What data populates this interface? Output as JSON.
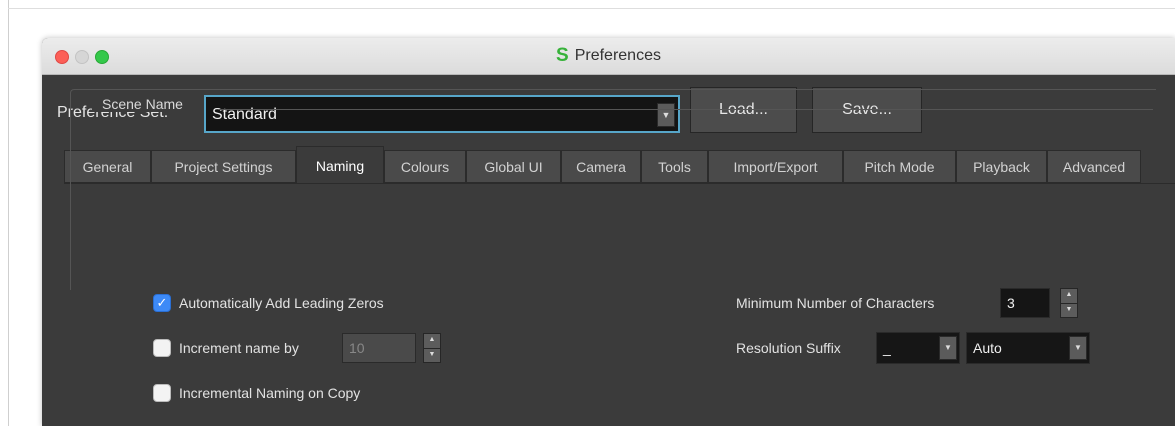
{
  "window": {
    "title": "Preferences",
    "app_icon": "S"
  },
  "toolbar": {
    "preference_set_label": "Preference Set:",
    "preference_set_value": "Standard",
    "load_label": "Load...",
    "save_label": "Save..."
  },
  "tabs": [
    {
      "label": "General"
    },
    {
      "label": "Project Settings"
    },
    {
      "label": "Naming",
      "active": true
    },
    {
      "label": "Colours"
    },
    {
      "label": "Global UI"
    },
    {
      "label": "Camera"
    },
    {
      "label": "Tools"
    },
    {
      "label": "Import/Export"
    },
    {
      "label": "Pitch Mode"
    },
    {
      "label": "Playback"
    },
    {
      "label": "Advanced"
    }
  ],
  "scene_name": {
    "group_title": "Scene Name",
    "auto_leading_zeros": {
      "label": "Automatically Add Leading Zeros",
      "checked": true
    },
    "increment_name": {
      "label": "Increment name by",
      "checked": false,
      "value": "10"
    },
    "incremental_copy": {
      "label": "Incremental Naming on Copy",
      "checked": false
    },
    "min_chars": {
      "label": "Minimum Number of Characters",
      "value": "3"
    },
    "resolution_suffix": {
      "label": "Resolution Suffix",
      "separator": "_",
      "mode": "Auto"
    }
  },
  "colors": {
    "accent": "#3d8af7",
    "focus_border": "#57a6c9",
    "window_bg": "#3b3b3b",
    "app_icon": "#37b23a"
  }
}
